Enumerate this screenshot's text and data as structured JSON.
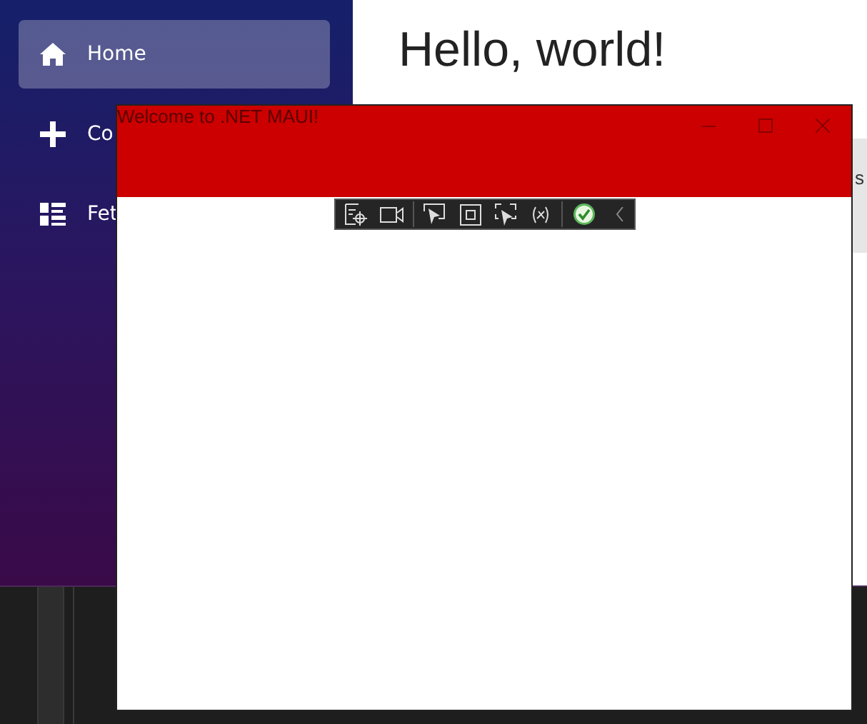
{
  "host_app": {
    "sidebar": {
      "items": [
        {
          "label": "Home",
          "selected": true
        },
        {
          "label": "Co",
          "selected": false
        },
        {
          "label": "Fet",
          "selected": false
        }
      ]
    },
    "content": {
      "heading": "Hello, world!",
      "side_tab": "s"
    }
  },
  "maui_window": {
    "title": "Welcome to .NET MAUI!"
  }
}
